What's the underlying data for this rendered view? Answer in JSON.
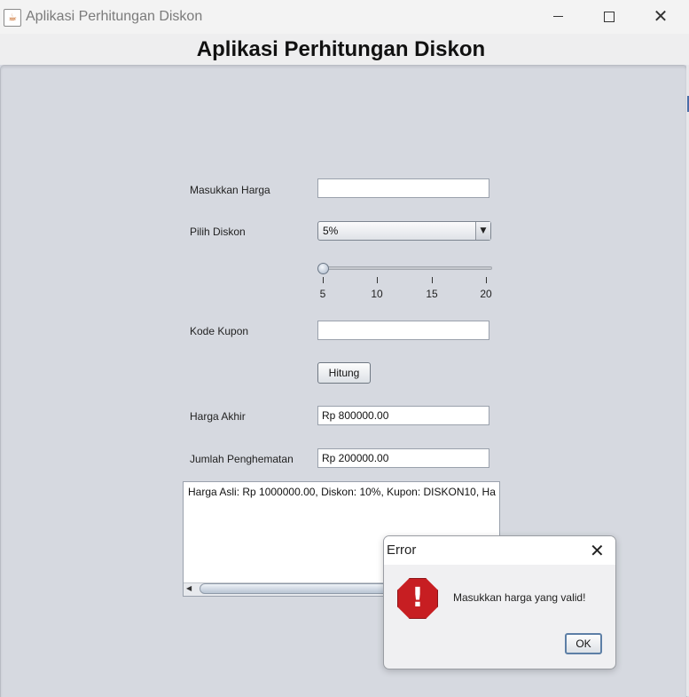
{
  "window": {
    "title": "Aplikasi Perhitungan Diskon",
    "app_icon": "java-cup-icon"
  },
  "main": {
    "heading": "Aplikasi Perhitungan Diskon",
    "form": {
      "harga_label": "Masukkan Harga",
      "harga_value": "",
      "diskon_label": "Pilih Diskon",
      "diskon_selected": "5%",
      "slider": {
        "value": 5,
        "min": 5,
        "max": 20,
        "ticks": [
          "5",
          "10",
          "15",
          "20"
        ]
      },
      "kupon_label": "Kode Kupon",
      "kupon_value": "",
      "hitung_button": "Hitung",
      "harga_akhir_label": "Harga Akhir",
      "harga_akhir_value": "Rp 800000.00",
      "hemat_label": "Jumlah Penghematan",
      "hemat_value": "Rp 200000.00"
    },
    "output_text": "Harga Asli: Rp 1000000.00, Diskon: 10%, Kupon: DISKON10, Ha"
  },
  "dialog": {
    "title": "Error",
    "message": "Masukkan harga yang valid!",
    "ok_button": "OK",
    "icon": "error-icon"
  },
  "colors": {
    "panel_bg": "#d6d9e0",
    "error_red": "#c71e22",
    "focus_border": "#5d7fa6"
  }
}
